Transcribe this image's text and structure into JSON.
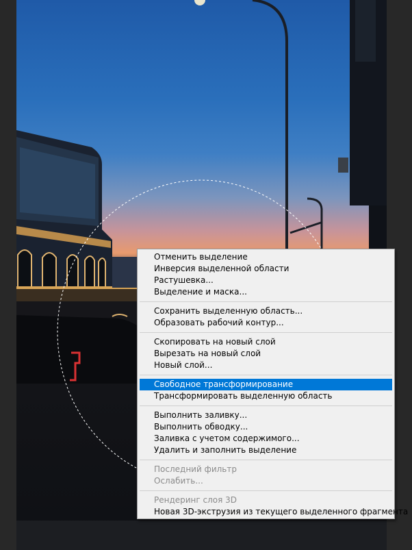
{
  "canvas": {
    "background_color": "#282828",
    "image_subject": "photo"
  },
  "context_menu": {
    "highlight_color": "#0078d7",
    "groups": [
      {
        "items": [
          {
            "label": "Отменить выделение",
            "enabled": true
          },
          {
            "label": "Инверсия выделенной области",
            "enabled": true
          },
          {
            "label": "Растушевка...",
            "enabled": true
          },
          {
            "label": "Выделение и маска...",
            "enabled": true
          }
        ]
      },
      {
        "items": [
          {
            "label": "Сохранить выделенную область...",
            "enabled": true
          },
          {
            "label": "Образовать рабочий контур...",
            "enabled": true
          }
        ]
      },
      {
        "items": [
          {
            "label": "Скопировать на новый слой",
            "enabled": true
          },
          {
            "label": "Вырезать на новый слой",
            "enabled": true
          },
          {
            "label": "Новый слой...",
            "enabled": true
          }
        ]
      },
      {
        "items": [
          {
            "label": "Свободное трансформирование",
            "enabled": true,
            "highlighted": true
          },
          {
            "label": "Трансформировать выделенную область",
            "enabled": true
          }
        ]
      },
      {
        "items": [
          {
            "label": "Выполнить заливку...",
            "enabled": true
          },
          {
            "label": "Выполнить обводку...",
            "enabled": true
          },
          {
            "label": "Заливка с учетом содержимого...",
            "enabled": true
          },
          {
            "label": "Удалить и заполнить выделение",
            "enabled": true
          }
        ]
      },
      {
        "items": [
          {
            "label": "Последний фильтр",
            "enabled": false
          },
          {
            "label": "Ослабить...",
            "enabled": false
          }
        ]
      },
      {
        "items": [
          {
            "label": "Рендеринг слоя 3D",
            "enabled": false
          },
          {
            "label": "Новая 3D-экструзия из текущего выделенного фрагмента",
            "enabled": true
          }
        ]
      }
    ]
  }
}
